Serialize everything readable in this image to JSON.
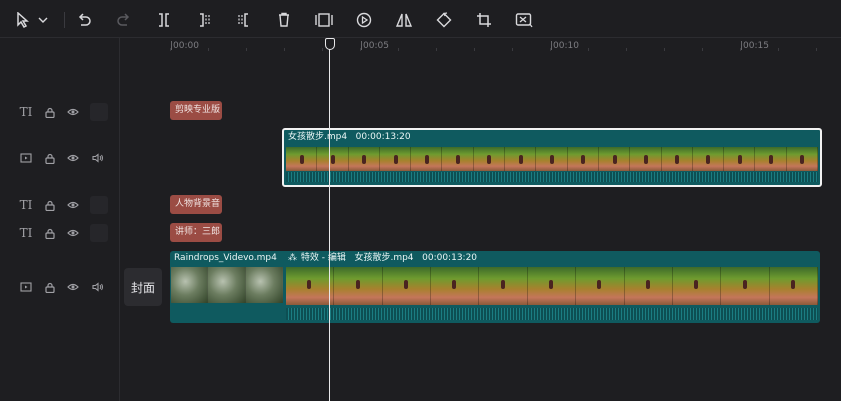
{
  "toolbar": {
    "tools": [
      {
        "icon": "select-cursor-icon"
      },
      {
        "icon": "chevron-down-icon"
      },
      {
        "icon": "undo-icon"
      },
      {
        "icon": "redo-icon"
      },
      {
        "icon": "split-icon"
      },
      {
        "icon": "trim-left-icon"
      },
      {
        "icon": "trim-right-icon"
      },
      {
        "icon": "delete-icon"
      },
      {
        "icon": "freeze-frame-icon"
      },
      {
        "icon": "play-reverse-icon"
      },
      {
        "icon": "mirror-icon"
      },
      {
        "icon": "rotate-icon"
      },
      {
        "icon": "crop-icon"
      },
      {
        "icon": "smart-cut-icon"
      }
    ]
  },
  "ruler": {
    "labels": [
      "|00:00",
      "|00:05",
      "|00:10",
      "|00:15"
    ]
  },
  "tracks": {
    "text1_clip": "剪映专业版",
    "video_clip": {
      "name": "女孩散步.mp4",
      "duration": "00:00:13:20"
    },
    "text2_clip": "人物背景音",
    "text3_clip": "讲师：三郎",
    "main_clip": {
      "name": "Raindrops_Videvo.mp4",
      "effect_label": "特效 - 编辑",
      "second_name": "女孩散步.mp4",
      "second_duration": "00:00:13:20"
    }
  },
  "cover": {
    "label": "封面"
  },
  "track_header_icons": {
    "text_track": [
      "text-track-icon",
      "lock-icon",
      "eye-icon"
    ],
    "video_track": [
      "video-track-icon",
      "lock-icon",
      "eye-icon",
      "audio-icon"
    ]
  },
  "colors": {
    "background": "#1e1e21",
    "text_clip": "#9b4c44",
    "video_clip": "#0f5a5f",
    "playhead": "#e8e8ea"
  }
}
